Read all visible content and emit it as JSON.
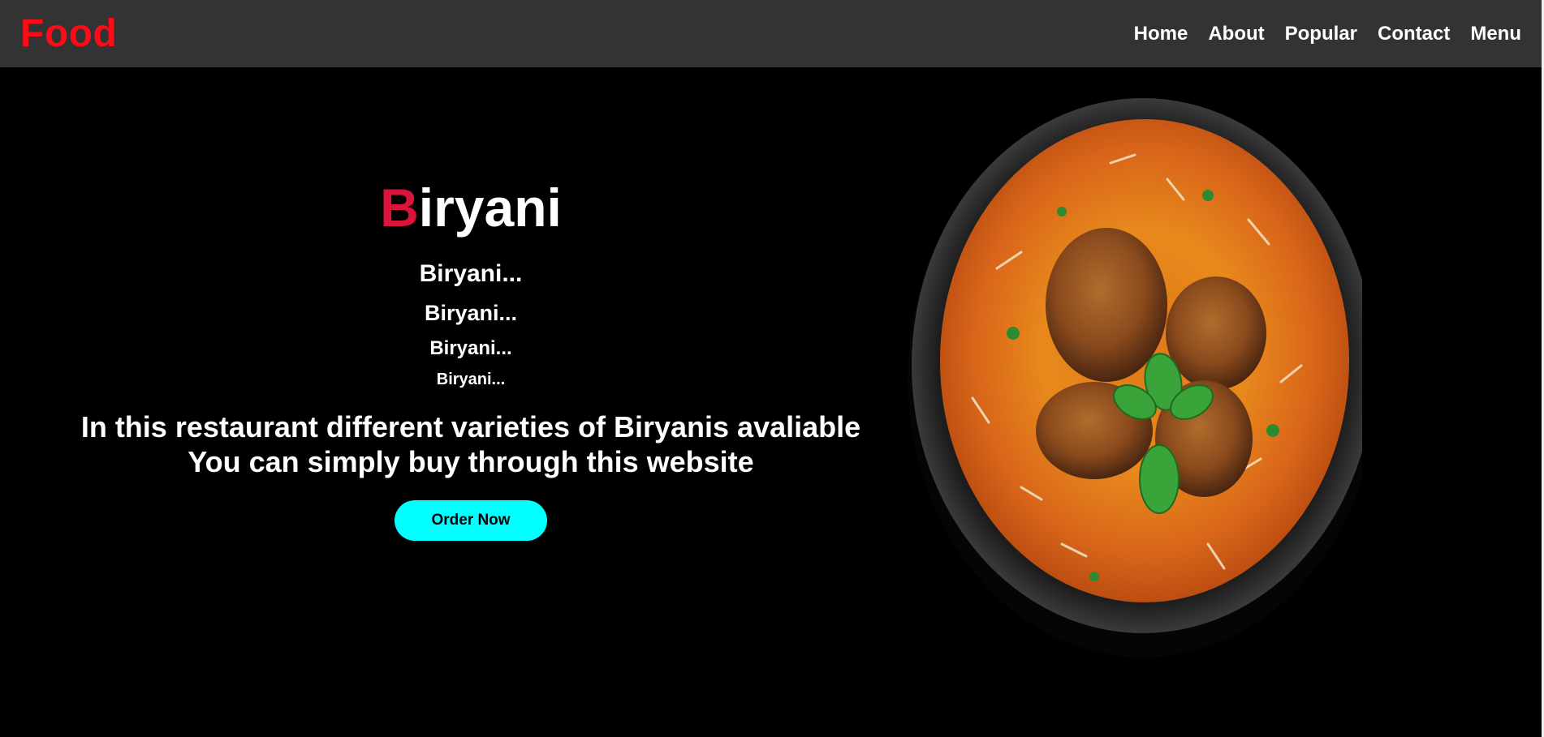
{
  "navbar": {
    "logo": "Food",
    "links": [
      "Home",
      "About",
      "Popular",
      "Contact",
      "Menu"
    ]
  },
  "hero": {
    "title_first_letter": "B",
    "title_rest": "iryani",
    "subtitles": [
      "Biryani...",
      "Biryani...",
      "Biryani...",
      "Biryani..."
    ],
    "description_line1": "In this restaurant different varieties of Biryanis avaliable",
    "description_line2": "You can simply buy through this website",
    "order_button": "Order Now"
  },
  "colors": {
    "navbar_bg": "#333333",
    "logo": "#ff0a16",
    "title_accent": "#dc143c",
    "button_bg": "#00ffff",
    "page_bg": "#000000"
  }
}
